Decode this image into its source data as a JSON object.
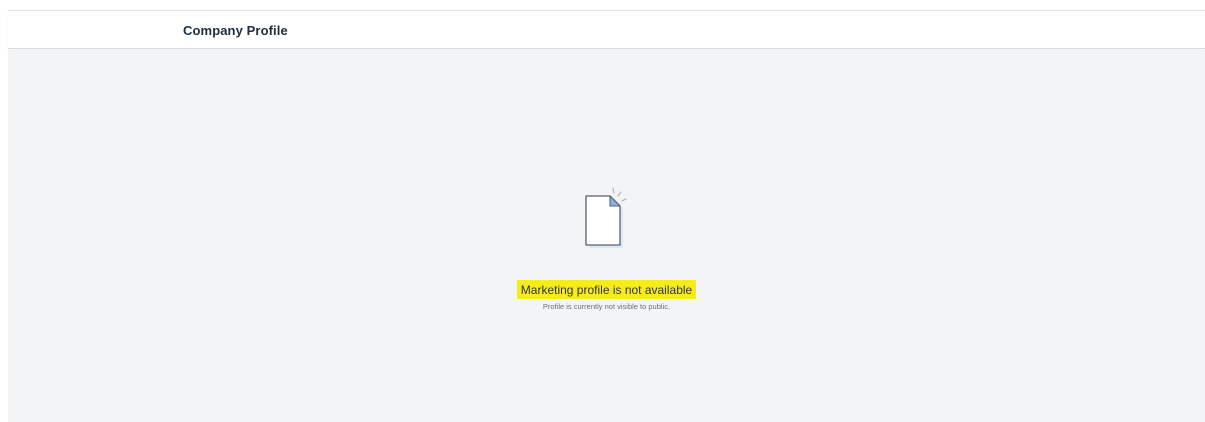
{
  "header": {
    "title": "Company Profile"
  },
  "empty_state": {
    "icon": "document-icon",
    "title": "Marketing profile is not available",
    "subtitle": "Profile is currently not visible to public."
  },
  "colors": {
    "background": "#f3f4f6",
    "highlight": "#f5ec1b",
    "icon_accent": "#8ab4e8"
  }
}
